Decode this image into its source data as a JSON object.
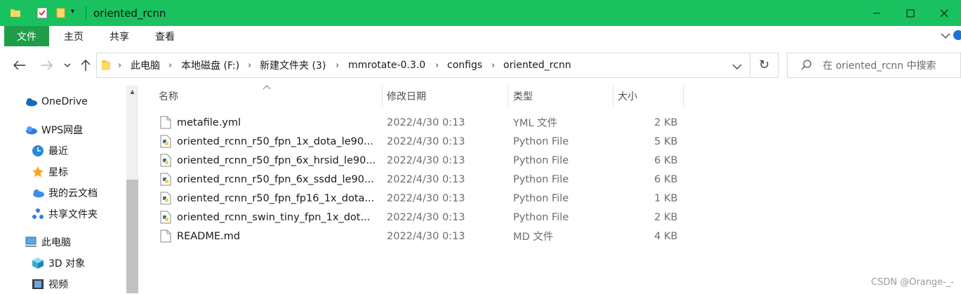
{
  "window": {
    "title": "oriented_rcnn",
    "accent_color": "#19c25e",
    "file_tab_color": "#1f9e49"
  },
  "ribbon": {
    "tabs": [
      "文件",
      "主页",
      "共享",
      "查看"
    ]
  },
  "address": {
    "crumbs": [
      "此电脑",
      "本地磁盘 (F:)",
      "新建文件夹 (3)",
      "mmrotate-0.3.0",
      "configs",
      "oriented_rcnn"
    ]
  },
  "search": {
    "placeholder": "在 oriented_rcnn 中搜索"
  },
  "sidebar": {
    "items": [
      {
        "label": "OneDrive",
        "icon": "cloud-icon"
      },
      {
        "label": "WPS网盘",
        "icon": "wps-cloud-icon"
      },
      {
        "label": "最近",
        "icon": "clock-icon"
      },
      {
        "label": "星标",
        "icon": "star-icon"
      },
      {
        "label": "我的云文档",
        "icon": "cloud-doc-icon"
      },
      {
        "label": "共享文件夹",
        "icon": "share-icon"
      },
      {
        "label": "此电脑",
        "icon": "computer-icon"
      },
      {
        "label": "3D 对象",
        "icon": "cube-icon"
      },
      {
        "label": "视频",
        "icon": "film-icon"
      }
    ]
  },
  "columns": {
    "name": "名称",
    "date": "修改日期",
    "type": "类型",
    "size": "大小"
  },
  "files": [
    {
      "name": "metafile.yml",
      "date": "2022/4/30 0:13",
      "type": "YML 文件",
      "size": "2 KB",
      "icon": "document-icon"
    },
    {
      "name": "oriented_rcnn_r50_fpn_1x_dota_le90...",
      "date": "2022/4/30 0:13",
      "type": "Python File",
      "size": "5 KB",
      "icon": "python-icon"
    },
    {
      "name": "oriented_rcnn_r50_fpn_6x_hrsid_le90...",
      "date": "2022/4/30 0:13",
      "type": "Python File",
      "size": "6 KB",
      "icon": "python-icon"
    },
    {
      "name": "oriented_rcnn_r50_fpn_6x_ssdd_le90...",
      "date": "2022/4/30 0:13",
      "type": "Python File",
      "size": "6 KB",
      "icon": "python-icon"
    },
    {
      "name": "oriented_rcnn_r50_fpn_fp16_1x_dota...",
      "date": "2022/4/30 0:13",
      "type": "Python File",
      "size": "1 KB",
      "icon": "python-icon"
    },
    {
      "name": "oriented_rcnn_swin_tiny_fpn_1x_dot...",
      "date": "2022/4/30 0:13",
      "type": "Python File",
      "size": "2 KB",
      "icon": "python-icon"
    },
    {
      "name": "README.md",
      "date": "2022/4/30 0:13",
      "type": "MD 文件",
      "size": "4 KB",
      "icon": "document-icon"
    }
  ],
  "watermark": "CSDN @Orange-_-"
}
